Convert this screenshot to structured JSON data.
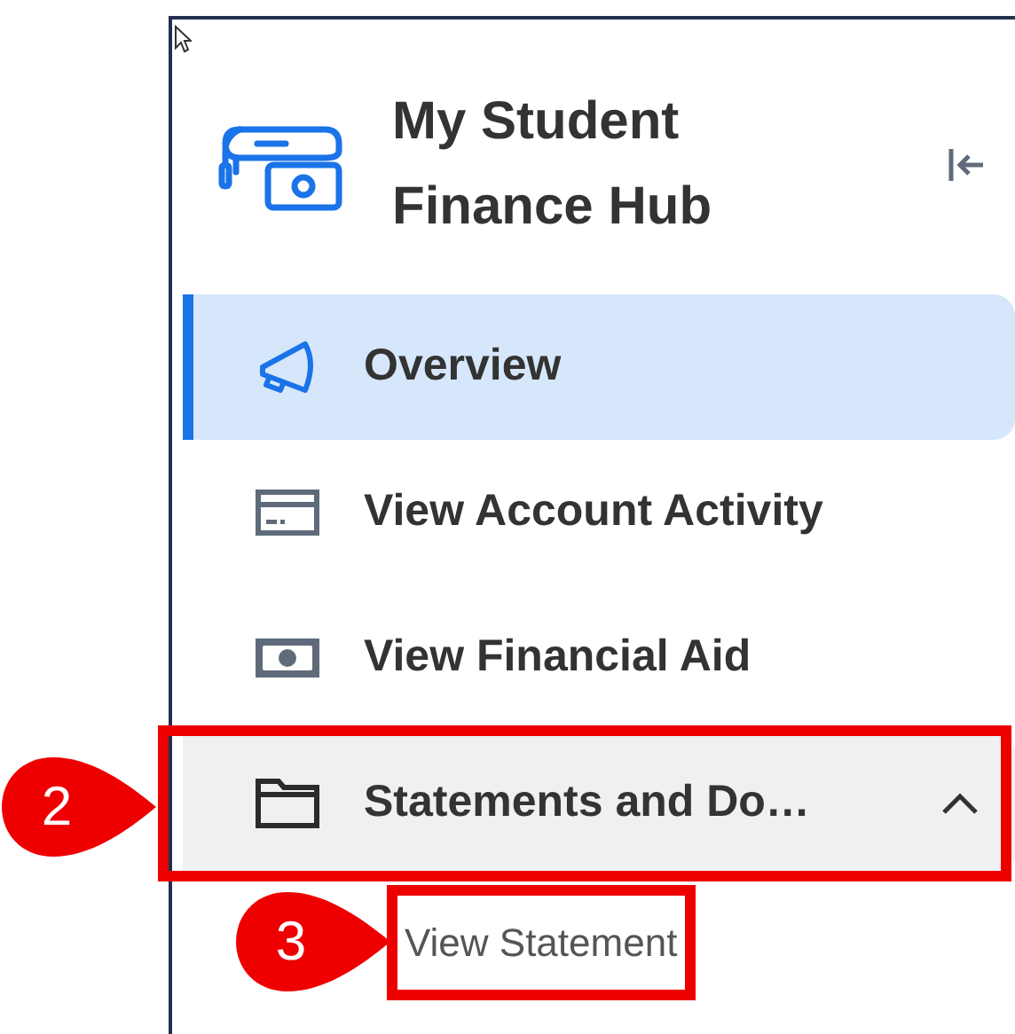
{
  "header": {
    "title": "My Student Finance Hub"
  },
  "nav": [
    {
      "kind": "link",
      "label": "Overview",
      "selected": true
    },
    {
      "kind": "link",
      "label": "View Account Activity",
      "selected": false
    },
    {
      "kind": "link",
      "label": "View Financial Aid",
      "selected": false
    },
    {
      "kind": "group",
      "label": "Statements and Do…",
      "selected": false,
      "expanded": true,
      "callout": "2",
      "children": [
        {
          "label": "View Statement",
          "callout": "3"
        }
      ]
    }
  ]
}
